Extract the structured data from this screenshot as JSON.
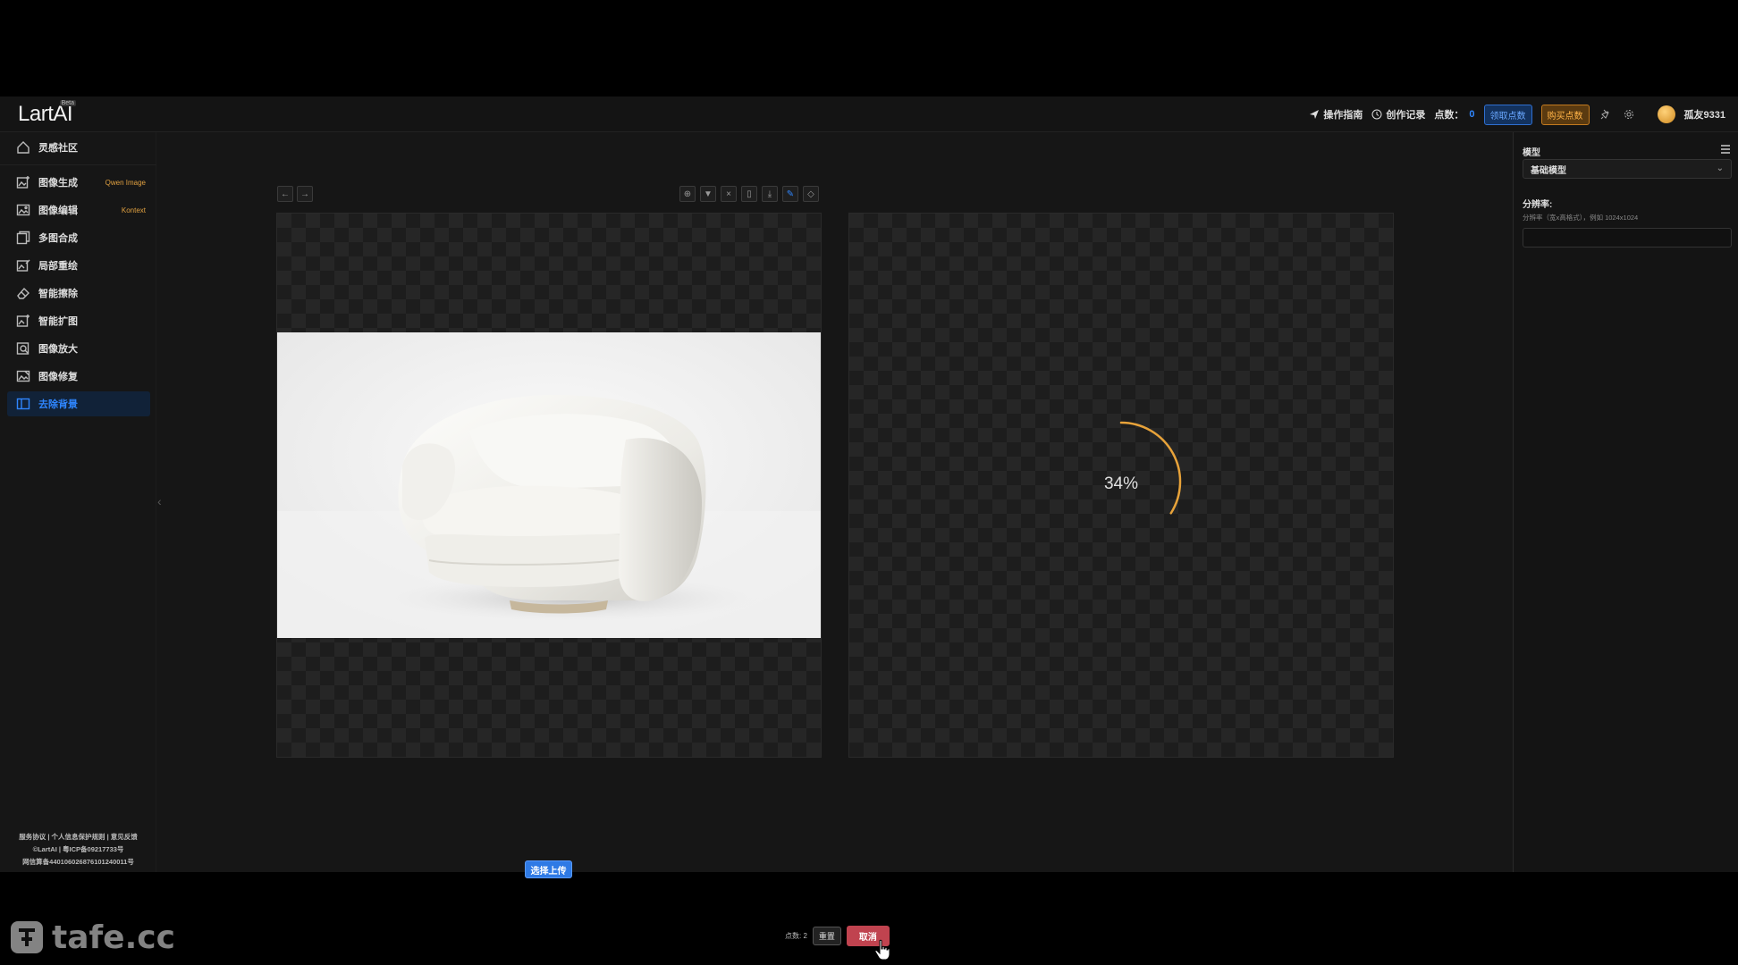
{
  "header": {
    "logo": "LartAI",
    "logo_tag": "Beta",
    "guide_label": "操作指南",
    "history_label": "创作记录",
    "points_label": "点数：",
    "points_value": "0",
    "claim_label": "领取点数",
    "buy_label": "购买点数",
    "username": "孤友9331"
  },
  "sidebar": {
    "community": "灵感社区",
    "items": [
      {
        "label": "图像生成",
        "badge": "Qwen Image"
      },
      {
        "label": "图像编辑",
        "badge": "Kontext"
      },
      {
        "label": "多图合成",
        "badge": ""
      },
      {
        "label": "局部重绘",
        "badge": ""
      },
      {
        "label": "智能擦除",
        "badge": ""
      },
      {
        "label": "智能扩图",
        "badge": ""
      },
      {
        "label": "图像放大",
        "badge": ""
      },
      {
        "label": "图像修复",
        "badge": ""
      },
      {
        "label": "去除背景",
        "badge": ""
      }
    ],
    "active_index": 8,
    "footer": {
      "line1": "服务协议 | 个人信息保护规则 | 意见反馈",
      "line2": "©LartAI | 粤ICP备09217733号",
      "line3": "网信算备440106026876101240011号"
    }
  },
  "workspace": {
    "progress_text": "34%",
    "progress_value": 0.34,
    "upload_label": "选择上传",
    "bottom_points": "点数: 2",
    "reset_label": "重置",
    "cancel_label": "取消"
  },
  "right_panel": {
    "model_title": "模型",
    "model_selected": "基础模型",
    "resolution_label": "分辨率:",
    "resolution_hint": "分辨率（宽x高格式），例如 1024x1024",
    "resolution_value": ""
  },
  "watermark": {
    "text": "tafe.cc"
  },
  "colors": {
    "accent_blue": "#2f86ff",
    "accent_orange": "#ffb347",
    "cancel_red": "#c0434f",
    "progress_arc": "#e8a33a"
  }
}
